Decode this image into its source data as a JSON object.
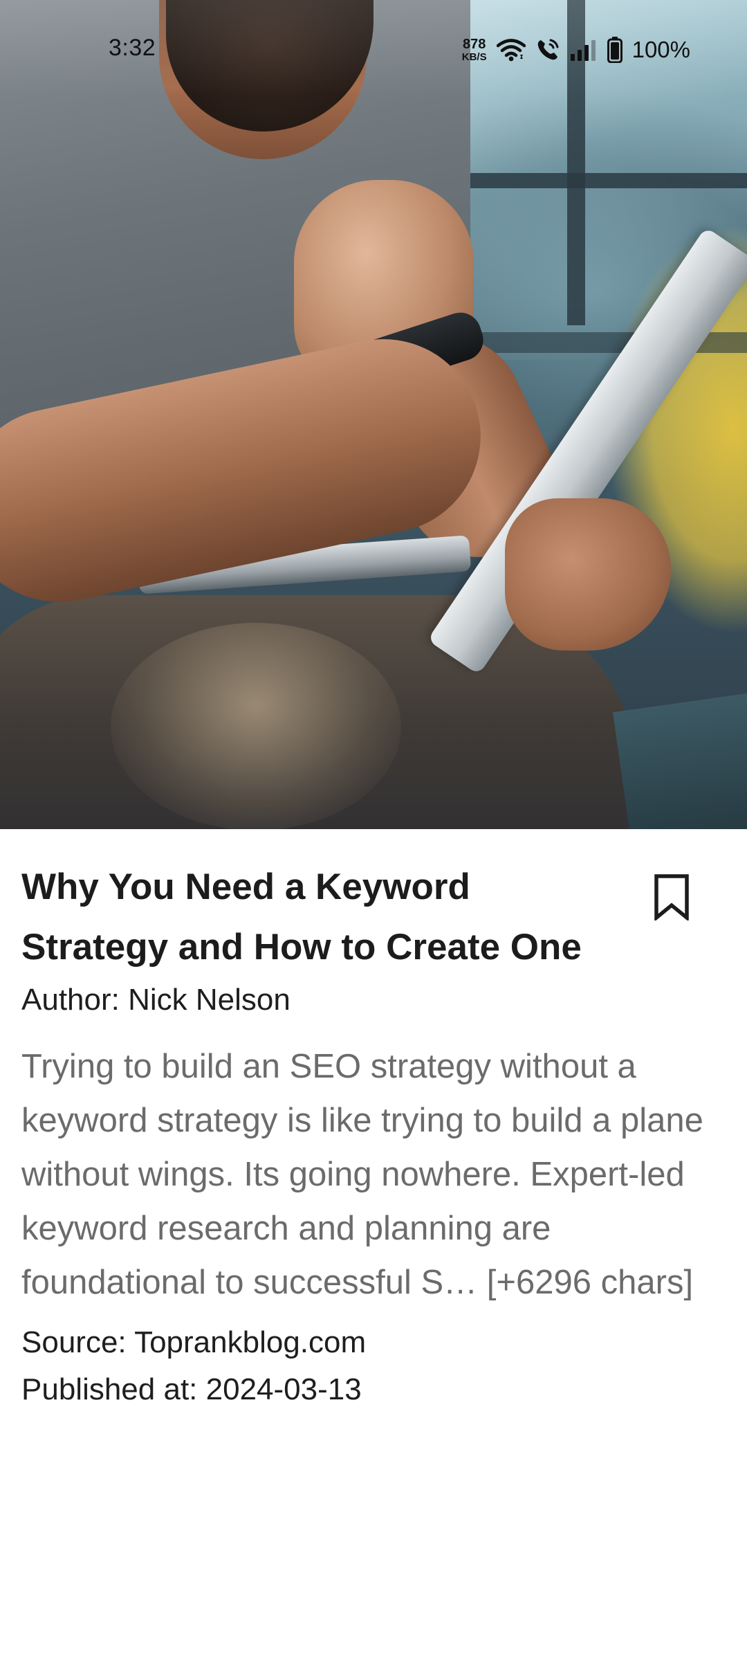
{
  "status_bar": {
    "time": "3:32",
    "net_speed_value": "878",
    "net_speed_unit": "KB/S",
    "battery": "100%",
    "icons": [
      "wifi-icon",
      "call-icon",
      "signal-icon",
      "battery-icon"
    ]
  },
  "article": {
    "title": "Why You Need a Keyword Strategy and How to Create One",
    "author": "Author: Nick Nelson",
    "description": "Trying to build an SEO strategy without a keyword strategy is like trying to build a plane without wings. Its going nowhere. Expert-led keyword research and planning are foundational to successful S… [+6296 chars]",
    "source": "Source: Toprankblog.com",
    "published": "Published at: 2024-03-13",
    "bookmark_icon": "bookmark-icon"
  },
  "colors": {
    "title": "#1c1c1c",
    "body_text": "#6b6b6b",
    "meta_text": "#1e1e1e",
    "background": "#ffffff"
  }
}
